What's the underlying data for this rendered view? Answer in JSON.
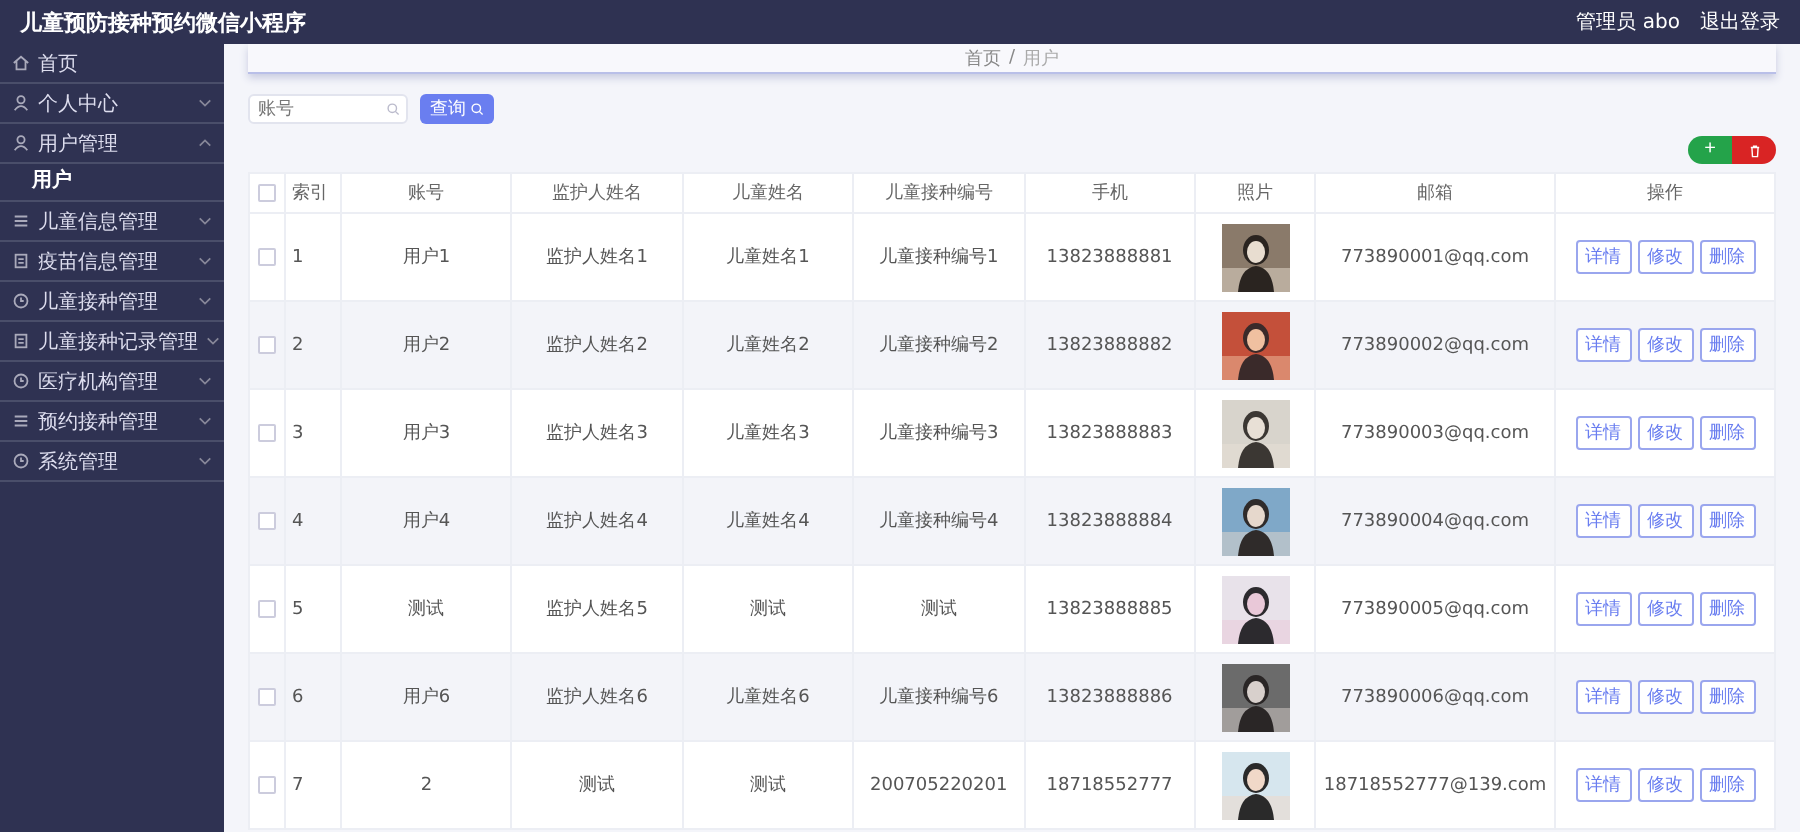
{
  "app_title": "儿童预防接种预约微信小程序",
  "user": "管理员 abo",
  "logout": "退出登录",
  "sidebar": {
    "items": [
      {
        "label": "首页"
      },
      {
        "label": "个人中心",
        "expanded": false
      },
      {
        "label": "用户管理",
        "expanded": true,
        "children": [
          {
            "label": "用户",
            "selected": true
          }
        ]
      },
      {
        "label": "儿童信息管理",
        "expanded": false
      },
      {
        "label": "疫苗信息管理",
        "expanded": false
      },
      {
        "label": "儿童接种管理",
        "expanded": false
      },
      {
        "label": "儿童接种记录管理",
        "expanded": false
      },
      {
        "label": "医疗机构管理",
        "expanded": false
      },
      {
        "label": "预约接种管理",
        "expanded": false
      },
      {
        "label": "系统管理",
        "expanded": false
      }
    ]
  },
  "breadcrumb": {
    "items": [
      "首页",
      "用户"
    ],
    "separator": "/"
  },
  "search": {
    "placeholder": "账号",
    "button": "查询"
  },
  "add_button": "+",
  "table": {
    "columns": [
      "索引",
      "账号",
      "监护人姓名",
      "儿童姓名",
      "儿童接种编号",
      "手机",
      "照片",
      "邮箱",
      "操作"
    ],
    "header_checked": false,
    "rows": [
      {
        "checked": false,
        "index": "1",
        "account": "用户1",
        "guardian": "监护人姓名1",
        "child": "儿童姓名1",
        "number": "儿童接种编号1",
        "phone": "13823888881",
        "email": "773890001@qq.com",
        "actions": [
          "详情",
          "修改",
          "删除"
        ]
      },
      {
        "checked": false,
        "index": "2",
        "account": "用户2",
        "guardian": "监护人姓名2",
        "child": "儿童姓名2",
        "number": "儿童接种编号2",
        "phone": "13823888882",
        "email": "773890002@qq.com",
        "actions": [
          "详情",
          "修改",
          "删除"
        ]
      },
      {
        "checked": false,
        "index": "3",
        "account": "用户3",
        "guardian": "监护人姓名3",
        "child": "儿童姓名3",
        "number": "儿童接种编号3",
        "phone": "13823888883",
        "email": "773890003@qq.com",
        "actions": [
          "详情",
          "修改",
          "删除"
        ]
      },
      {
        "checked": false,
        "index": "4",
        "account": "用户4",
        "guardian": "监护人姓名4",
        "child": "儿童姓名4",
        "number": "儿童接种编号4",
        "phone": "13823888884",
        "email": "773890004@qq.com",
        "actions": [
          "详情",
          "修改",
          "删除"
        ]
      },
      {
        "checked": false,
        "index": "5",
        "account": "测试",
        "guardian": "监护人姓名5",
        "child": "测试",
        "number": "测试",
        "phone": "13823888885",
        "email": "773890005@qq.com",
        "actions": [
          "详情",
          "修改",
          "删除"
        ]
      },
      {
        "checked": false,
        "index": "6",
        "account": "用户6",
        "guardian": "监护人姓名6",
        "child": "儿童姓名6",
        "number": "儿童接种编号6",
        "phone": "13823888886",
        "email": "773890006@qq.com",
        "actions": [
          "详情",
          "修改",
          "删除"
        ]
      },
      {
        "checked": false,
        "index": "7",
        "account": "2",
        "guardian": "测试",
        "child": "测试",
        "number": "200705220201",
        "phone": "18718552777",
        "email": "18718552777@139.com",
        "actions": [
          "详情",
          "修改",
          "删除"
        ]
      }
    ]
  }
}
